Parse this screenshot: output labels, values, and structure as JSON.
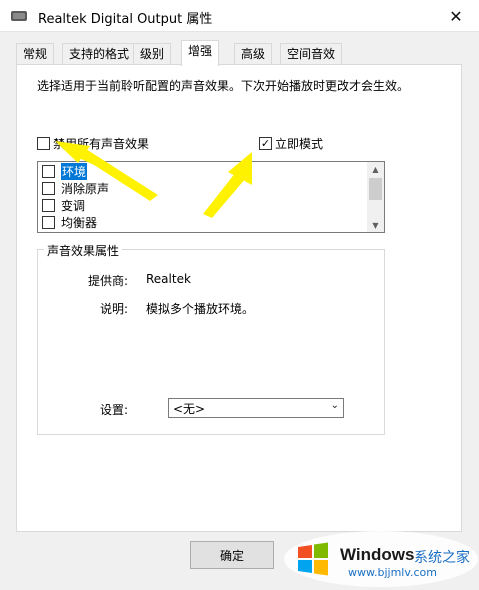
{
  "window": {
    "title": "Realtek Digital Output 属性",
    "close_glyph": "✕"
  },
  "tabs": [
    {
      "label": "常规"
    },
    {
      "label": "支持的格式"
    },
    {
      "label": "级别"
    },
    {
      "label": "增强"
    },
    {
      "label": "高级"
    },
    {
      "label": "空间音效"
    }
  ],
  "active_tab_index": 3,
  "enhancements": {
    "description": "选择适用于当前聆听配置的声音效果。下次开始播放时更改才会生效。",
    "disable_all_label": "禁用所有声音效果",
    "disable_all_checked": false,
    "immediate_mode_label": "立即模式",
    "immediate_mode_checked": true,
    "check_mark": "✓",
    "effects": [
      {
        "label": "环境",
        "checked": false,
        "selected": true
      },
      {
        "label": "消除原声",
        "checked": false,
        "selected": false
      },
      {
        "label": "变调",
        "checked": false,
        "selected": false
      },
      {
        "label": "均衡器",
        "checked": false,
        "selected": false
      }
    ],
    "scroll_up_glyph": "▲",
    "scroll_down_glyph": "▼"
  },
  "properties": {
    "group_title": "声音效果属性",
    "provider_label": "提供商:",
    "provider_value": "Realtek",
    "description_label": "说明:",
    "description_value": "模拟多个播放环境。",
    "settings_label": "设置:",
    "settings_value": "<无>",
    "chevron_glyph": "⌄"
  },
  "buttons": {
    "ok_label": "确定"
  },
  "watermark": {
    "brand": "Windows",
    "suffix": "系统之家",
    "url": "www.bjjmlv.com"
  },
  "colors": {
    "selection": "#0078d7",
    "arrow": "#fff200",
    "win_red": "#f25022",
    "win_green": "#7fba00",
    "win_blue": "#00a4ef",
    "win_yellow": "#ffb900"
  }
}
